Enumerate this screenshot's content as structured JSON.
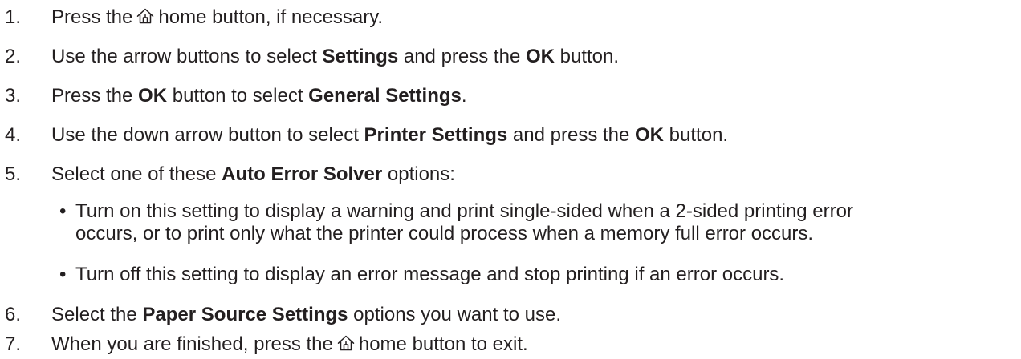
{
  "steps": [
    {
      "num": "1.",
      "parts": [
        "Press the",
        "home button, if necessary."
      ],
      "icon": "home-icon"
    },
    {
      "num": "2.",
      "parts": [
        "Use the arrow buttons to select ",
        "Settings",
        " and press the ",
        "OK",
        " button."
      ]
    },
    {
      "num": "3.",
      "parts": [
        "Press the ",
        "OK",
        " button to select ",
        "General Settings",
        "."
      ]
    },
    {
      "num": "4.",
      "parts": [
        "Use the down arrow button to select ",
        "Printer Settings",
        " and press the ",
        "OK",
        " button."
      ]
    },
    {
      "num": "5.",
      "parts": [
        "Select one of these ",
        "Auto Error Solver",
        " options:"
      ]
    },
    {
      "num": "6.",
      "parts": [
        "Select the ",
        "Paper Source Settings",
        " options you want to use."
      ]
    },
    {
      "num": "7.",
      "parts": [
        "When you are finished, press the",
        "home button to exit."
      ],
      "icon": "home-icon"
    }
  ],
  "bullets": [
    {
      "symbol": "•",
      "lines": [
        "Turn on this setting to display a warning and print single-sided when a 2-sided printing error",
        "occurs, or to print only what the printer could process when a memory full error occurs."
      ]
    },
    {
      "symbol": "•",
      "lines": [
        "Turn off this setting to display an error message and stop printing if an error occurs."
      ]
    }
  ]
}
